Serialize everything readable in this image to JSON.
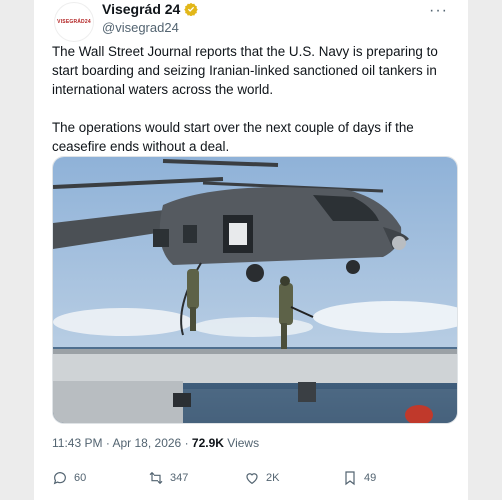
{
  "post": {
    "avatar_text": "VISEGRÁD24",
    "author_name": "Visegrád 24",
    "handle": "@visegrad24",
    "more_label": "···",
    "paragraphs": [
      "The Wall Street Journal reports that the U.S. Navy is preparing to start boarding and seizing Iranian-linked sanctioned oil tankers in international waters across the world.",
      "The operations would start over the next couple of days if the ceasefire ends without a deal."
    ],
    "time": "11:43 PM",
    "separator": "·",
    "date": "Apr 18, 2026",
    "views_count": "72.9K",
    "views_label": "Views"
  },
  "actions": {
    "replies": "60",
    "reposts": "347",
    "likes": "2K",
    "bookmarks": "49"
  },
  "colors": {
    "text": "#0f1419",
    "secondary": "#536471",
    "verified": "#e2b719",
    "sky": "#8fb2d8",
    "helicopter": "#4b5055"
  },
  "icons": [
    "verified-badge-icon",
    "more-icon",
    "reply-icon",
    "repost-icon",
    "like-icon",
    "bookmark-icon"
  ]
}
